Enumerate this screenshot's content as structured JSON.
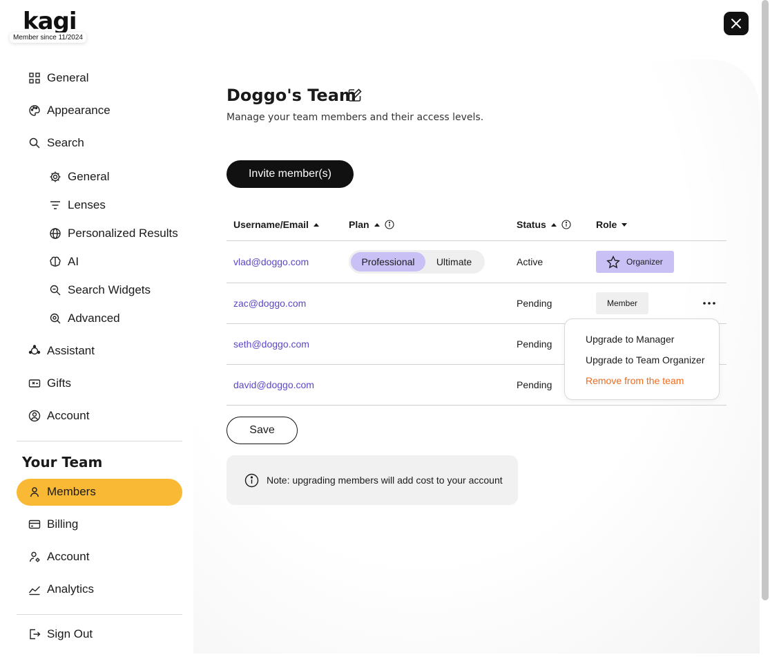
{
  "brand": {
    "logo_text": "kagi",
    "member_since": "Member since 11/2024"
  },
  "sidebar": {
    "items": [
      {
        "label": "General",
        "icon": "grid-icon"
      },
      {
        "label": "Appearance",
        "icon": "palette-icon"
      },
      {
        "label": "Search",
        "icon": "search-icon"
      }
    ],
    "search_sub": [
      {
        "label": "General",
        "icon": "gear-icon"
      },
      {
        "label": "Lenses",
        "icon": "filter-icon"
      },
      {
        "label": "Personalized Results",
        "icon": "globe-icon"
      },
      {
        "label": "AI",
        "icon": "brain-icon"
      },
      {
        "label": "Search Widgets",
        "icon": "search-widget-icon"
      },
      {
        "label": "Advanced",
        "icon": "advanced-gear-icon"
      }
    ],
    "items2": [
      {
        "label": "Assistant",
        "icon": "assistant-icon"
      },
      {
        "label": "Gifts",
        "icon": "gift-card-icon"
      },
      {
        "label": "Account",
        "icon": "user-circle-icon"
      }
    ],
    "team_section_title": "Your Team",
    "team_items": [
      {
        "label": "Members",
        "icon": "person-icon",
        "active": true
      },
      {
        "label": "Billing",
        "icon": "credit-card-icon"
      },
      {
        "label": "Account",
        "icon": "user-gear-icon"
      },
      {
        "label": "Analytics",
        "icon": "chart-line-icon"
      }
    ],
    "sign_out": {
      "label": "Sign Out",
      "icon": "sign-out-icon"
    }
  },
  "main": {
    "title": "Doggo's Team",
    "subtitle": "Manage your team members and their access levels.",
    "invite_label": "Invite member(s)",
    "columns": {
      "user": "Username/Email",
      "plan": "Plan",
      "status": "Status",
      "role": "Role"
    },
    "rows": [
      {
        "email": "vlad@doggo.com",
        "status": "Active",
        "role": "Organizer"
      },
      {
        "email": "zac@doggo.com",
        "status": "Pending",
        "role": "Member"
      },
      {
        "email": "seth@doggo.com",
        "status": "Pending"
      },
      {
        "email": "david@doggo.com",
        "status": "Pending"
      }
    ],
    "plan_options": [
      "Professional",
      "Ultimate"
    ],
    "plan_selected": "Professional",
    "menu": {
      "upgrade_manager": "Upgrade to Manager",
      "upgrade_organizer": "Upgrade to Team Organizer",
      "remove": "Remove from the team"
    },
    "save_label": "Save",
    "note": "Note: upgrading members will add cost to your account"
  },
  "colors": {
    "accent": "#f9b934",
    "link": "#5b47c9",
    "selected": "#c9c0f5",
    "danger": "#f06a1c"
  }
}
